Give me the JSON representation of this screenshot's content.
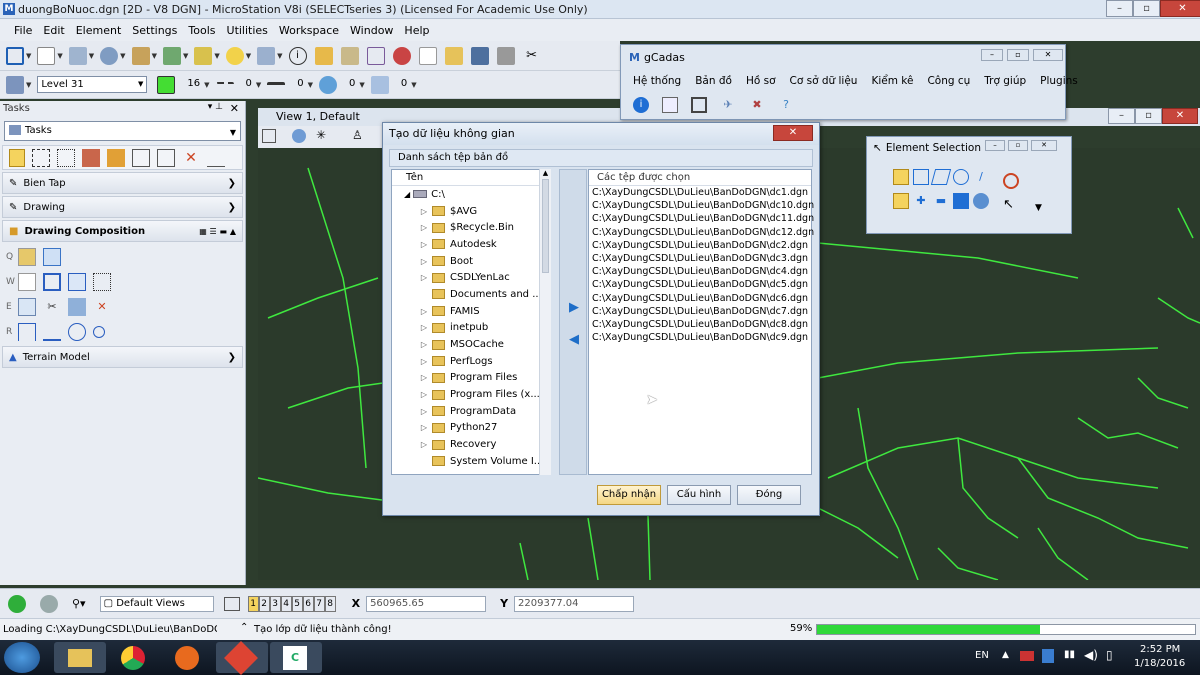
{
  "app": {
    "title": "duongBoNuoc.dgn [2D - V8 DGN] - MicroStation V8i (SELECTseries 3) (Licensed For Academic Use Only)"
  },
  "menu": [
    "File",
    "Edit",
    "Element",
    "Settings",
    "Tools",
    "Utilities",
    "Workspace",
    "Window",
    "Help"
  ],
  "attributes": {
    "level": "Level 31",
    "color": "16",
    "line_style": "0",
    "line_weight": "0",
    "transparency": "0",
    "priority": "0"
  },
  "tasks": {
    "panel_title": "Tasks",
    "combo_value": "Tasks",
    "sections": {
      "edit": "Bien Tap",
      "drawing": "Drawing",
      "composition": "Drawing Composition",
      "terrain": "Terrain Model"
    },
    "row_keys": [
      "Q",
      "W",
      "E",
      "R"
    ]
  },
  "view": {
    "title": "View 1, Default"
  },
  "dialog": {
    "title": "Tạo dữ liệu không gian",
    "group_label": "Danh sách tệp bản đồ",
    "tree_header": "Tên",
    "tree_root": "C:\\",
    "folders": [
      "$AVG",
      "$Recycle.Bin",
      "Autodesk",
      "Boot",
      "CSDLYenLac",
      "Documents and ...",
      "FAMIS",
      "inetpub",
      "MSOCache",
      "PerfLogs",
      "Program Files",
      "Program Files (x...",
      "ProgramData",
      "Python27",
      "Recovery",
      "System Volume I..."
    ],
    "files_header": "Các tệp được chọn",
    "files": [
      "C:\\XayDungCSDL\\DuLieu\\BanDoDGN\\dc1.dgn",
      "C:\\XayDungCSDL\\DuLieu\\BanDoDGN\\dc10.dgn",
      "C:\\XayDungCSDL\\DuLieu\\BanDoDGN\\dc11.dgn",
      "C:\\XayDungCSDL\\DuLieu\\BanDoDGN\\dc12.dgn",
      "C:\\XayDungCSDL\\DuLieu\\BanDoDGN\\dc2.dgn",
      "C:\\XayDungCSDL\\DuLieu\\BanDoDGN\\dc3.dgn",
      "C:\\XayDungCSDL\\DuLieu\\BanDoDGN\\dc4.dgn",
      "C:\\XayDungCSDL\\DuLieu\\BanDoDGN\\dc5.dgn",
      "C:\\XayDungCSDL\\DuLieu\\BanDoDGN\\dc6.dgn",
      "C:\\XayDungCSDL\\DuLieu\\BanDoDGN\\dc7.dgn",
      "C:\\XayDungCSDL\\DuLieu\\BanDoDGN\\dc8.dgn",
      "C:\\XayDungCSDL\\DuLieu\\BanDoDGN\\dc9.dgn"
    ],
    "accept": "Chấp nhận",
    "config": "Cấu hình",
    "close": "Đóng"
  },
  "gcadas": {
    "title": "gCadas",
    "menu": [
      "Hệ thống",
      "Bản đồ",
      "Hồ sơ",
      "Cơ sở dữ liệu",
      "Kiểm kê",
      "Công cụ",
      "Trợ giúp",
      "Plugins"
    ]
  },
  "element_selection": {
    "title": "Element Selection"
  },
  "status": {
    "views_combo": "Default Views",
    "view_numbers": [
      "1",
      "2",
      "3",
      "4",
      "5",
      "6",
      "7",
      "8"
    ],
    "x_label": "X",
    "x_value": "560965.65",
    "y_label": "Y",
    "y_value": "2209377.04",
    "loading": "Loading C:\\XayDungCSDL\\DuLieu\\BanDoDGN\\dc",
    "message": "Tạo lớp dữ liệu thành công!",
    "progress_text": "59%",
    "progress_value": 0.59
  },
  "taskbar": {
    "lang": "EN",
    "time": "2:52 PM",
    "date": "1/18/2016"
  },
  "colors": {
    "map_line": "#3fe83f",
    "view_bg": "#2b3a2b",
    "progress": "#2fd83a"
  }
}
